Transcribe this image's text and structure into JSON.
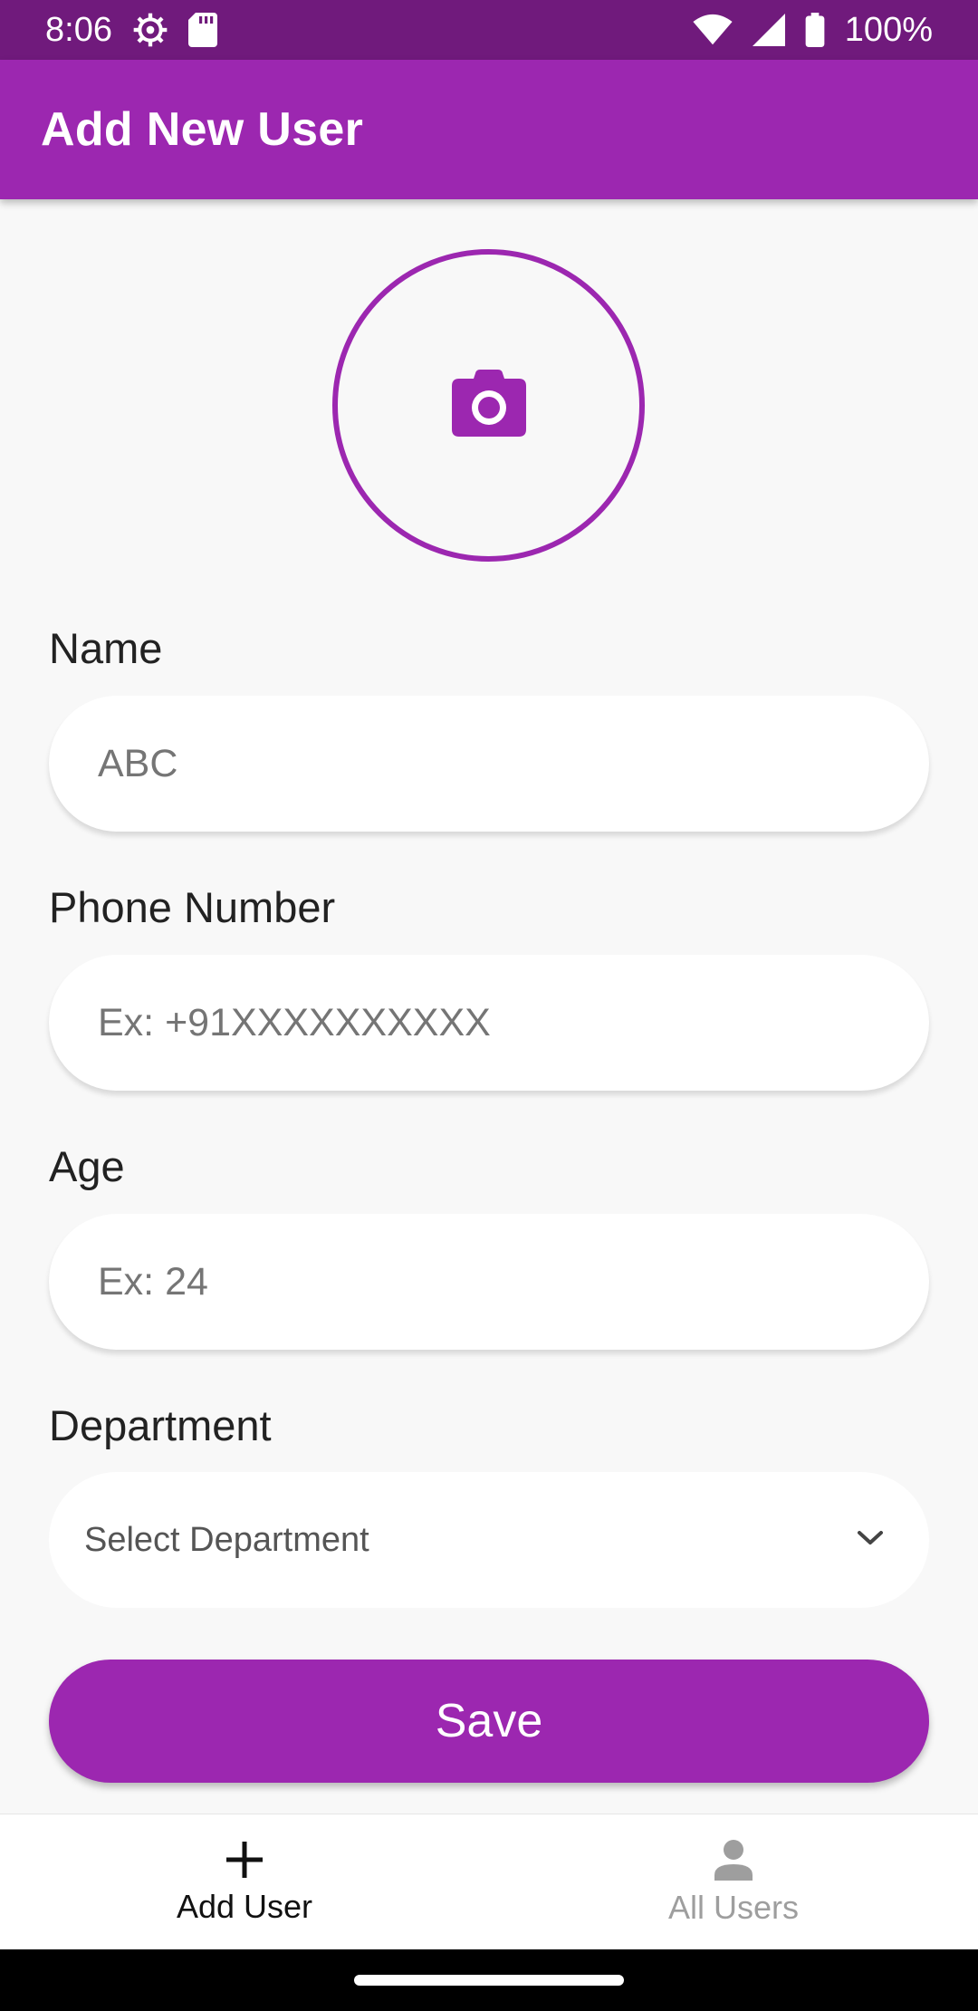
{
  "status_bar": {
    "time": "8:06",
    "battery_text": "100%",
    "icons": [
      "settings-gear-icon",
      "sd-card-icon",
      "wifi-icon",
      "signal-icon",
      "battery-icon"
    ]
  },
  "app_bar": {
    "title": "Add New User"
  },
  "avatar": {
    "icon": "camera-icon"
  },
  "form": {
    "name": {
      "label": "Name",
      "placeholder": "ABC",
      "value": ""
    },
    "phone": {
      "label": "Phone Number",
      "placeholder": "Ex: +91XXXXXXXXXX",
      "value": ""
    },
    "age": {
      "label": "Age",
      "placeholder": "Ex: 24",
      "value": ""
    },
    "department": {
      "label": "Department",
      "selected": "Select Department",
      "icon": "chevron-down-icon"
    },
    "save_label": "Save"
  },
  "bottom_nav": {
    "items": [
      {
        "label": "Add User",
        "icon": "plus-icon",
        "active": true
      },
      {
        "label": "All Users",
        "icon": "person-icon",
        "active": false
      }
    ]
  },
  "colors": {
    "primary": "#9c27b0",
    "status_bar": "#701a7c",
    "background": "#f8f8f8",
    "inactive": "#9e9e9e"
  }
}
